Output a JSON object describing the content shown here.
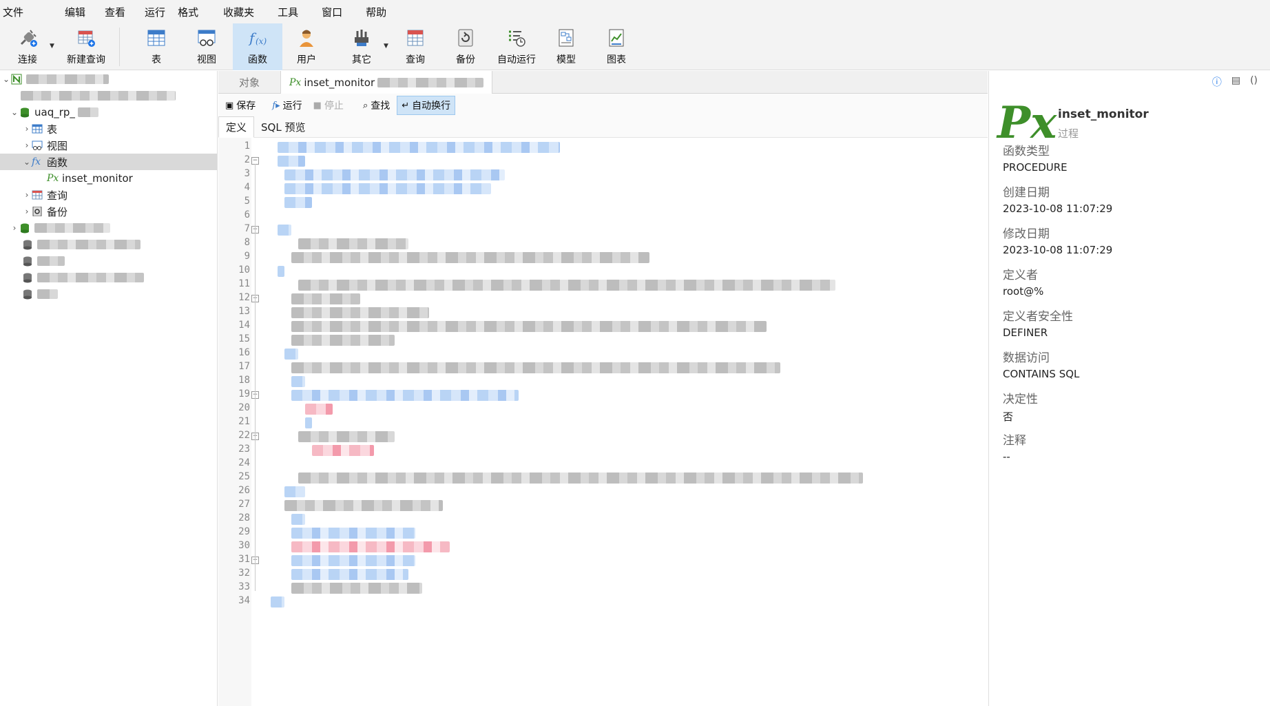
{
  "menu": [
    "文件",
    "编辑",
    "查看",
    "运行",
    "格式",
    "收藏夹",
    "工具",
    "窗口",
    "帮助"
  ],
  "toolbar": {
    "connect": "连接",
    "new_query": "新建查询",
    "table": "表",
    "view": "视图",
    "function": "函数",
    "user": "用户",
    "other": "其它",
    "query": "查询",
    "backup": "备份",
    "auto_run": "自动运行",
    "model": "模型",
    "chart": "图表"
  },
  "tree": {
    "db_prefix": "uaq_rp_",
    "table": "表",
    "view": "视图",
    "function": "函数",
    "function_item": "inset_monitor",
    "query": "查询",
    "backup": "备份"
  },
  "tabs": {
    "objects": "对象",
    "procedure": "inset_monitor"
  },
  "edit_toolbar": {
    "save": "保存",
    "run": "运行",
    "stop": "停止",
    "find": "查找",
    "wrap": "自动换行"
  },
  "subtabs": {
    "definition": "定义",
    "sql_preview": "SQL 预览"
  },
  "line_numbers": [
    "1",
    "2",
    "3",
    "4",
    "5",
    "6",
    "7",
    "8",
    "9",
    "10",
    "11",
    "12",
    "13",
    "14",
    "15",
    "16",
    "17",
    "18",
    "19",
    "20",
    "21",
    "22",
    "23",
    "24",
    "25",
    "26",
    "27",
    "28",
    "29",
    "30",
    "31",
    "32",
    "33",
    "34"
  ],
  "info": {
    "name": "inset_monitor",
    "kind": "过程",
    "props": [
      {
        "label": "函数类型",
        "value": "PROCEDURE"
      },
      {
        "label": "创建日期",
        "value": "2023-10-08 11:07:29"
      },
      {
        "label": "修改日期",
        "value": "2023-10-08 11:07:29"
      },
      {
        "label": "定义者",
        "value": "root@%"
      },
      {
        "label": "定义者安全性",
        "value": "DEFINER"
      },
      {
        "label": "数据访问",
        "value": "CONTAINS SQL"
      },
      {
        "label": "决定性",
        "value": "否"
      },
      {
        "label": "注释",
        "value": "--"
      }
    ]
  },
  "colors": {
    "accent": "#cfe4f7",
    "function_green": "#3e8f2a",
    "link_blue": "#1a73e8"
  }
}
